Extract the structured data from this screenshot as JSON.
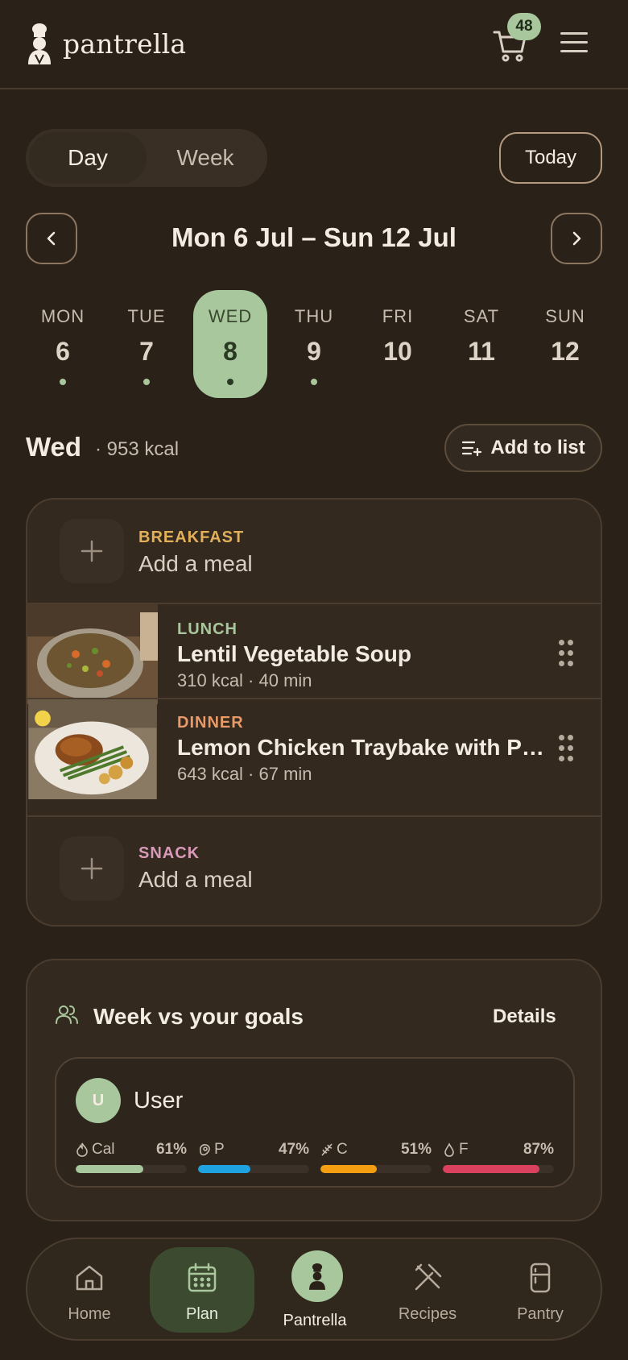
{
  "header": {
    "app_name": "pantrella",
    "cart_count": "48"
  },
  "view_toggle": {
    "day_label": "Day",
    "week_label": "Week",
    "selected": "Day"
  },
  "today_label": "Today",
  "week_range": "Mon 6 Jul – Sun 12 Jul",
  "days": [
    {
      "name": "MON",
      "num": "6",
      "has_dot": true,
      "selected": false
    },
    {
      "name": "TUE",
      "num": "7",
      "has_dot": true,
      "selected": false
    },
    {
      "name": "WED",
      "num": "8",
      "has_dot": true,
      "selected": true
    },
    {
      "name": "THU",
      "num": "9",
      "has_dot": true,
      "selected": false
    },
    {
      "name": "FRI",
      "num": "10",
      "has_dot": false,
      "selected": false
    },
    {
      "name": "SAT",
      "num": "11",
      "has_dot": false,
      "selected": false
    },
    {
      "name": "SUN",
      "num": "12",
      "has_dot": false,
      "selected": false
    }
  ],
  "day_summary": {
    "day": "Wed",
    "kcal": "· 953 kcal",
    "add_to_list_label": "Add to list"
  },
  "meals": {
    "breakfast": {
      "label": "BREAKFAST",
      "action": "Add a meal",
      "color": "#e3b05a"
    },
    "lunch": {
      "label": "LUNCH",
      "title": "Lentil Vegetable Soup",
      "meta": "310 kcal · 40 min",
      "color": "#a9c79c"
    },
    "dinner": {
      "label": "DINNER",
      "title": "Lemon Chicken Traybake with Potatoes",
      "meta": "643 kcal · 67 min",
      "color": "#e89a68"
    },
    "snack": {
      "label": "SNACK",
      "action": "Add a meal",
      "color": "#d79ab8"
    }
  },
  "goals": {
    "title": "Week vs your goals",
    "details_label": "Details",
    "user": {
      "initial": "U",
      "name": "User"
    },
    "metrics": [
      {
        "label": "Cal",
        "pct_text": "61%",
        "value": 0.61,
        "color": "#a9c79c",
        "icon": "flame-icon"
      },
      {
        "label": "P",
        "pct_text": "47%",
        "value": 0.47,
        "color": "#1fa3e0",
        "icon": "steak-icon"
      },
      {
        "label": "C",
        "pct_text": "51%",
        "value": 0.51,
        "color": "#f59e12",
        "icon": "wheat-icon"
      },
      {
        "label": "F",
        "pct_text": "87%",
        "value": 0.87,
        "color": "#d9415f",
        "icon": "droplet-icon"
      }
    ]
  },
  "bottom_nav": {
    "items": [
      {
        "label": "Home",
        "icon": "home-icon"
      },
      {
        "label": "Plan",
        "icon": "calendar-icon",
        "active": true
      },
      {
        "label": "Pantrella",
        "icon": "chef-icon"
      },
      {
        "label": "Recipes",
        "icon": "utensils-icon"
      },
      {
        "label": "Pantry",
        "icon": "fridge-icon"
      }
    ]
  }
}
